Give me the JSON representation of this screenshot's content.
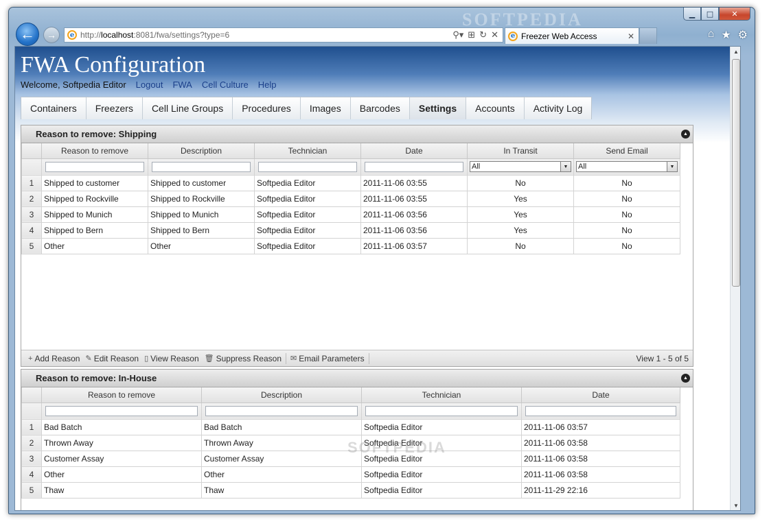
{
  "browser": {
    "watermark": "SOFTPEDIA",
    "url_prefix": "http://",
    "url_host": "localhost",
    "url_rest": ":8081/fwa/settings?type=6",
    "tab_title": "Freezer Web Access"
  },
  "header": {
    "title": "FWA Configuration",
    "welcome": "Welcome, Softpedia Editor",
    "links": [
      "Logout",
      "FWA",
      "Cell Culture",
      "Help"
    ]
  },
  "nav_tabs": [
    "Containers",
    "Freezers",
    "Cell Line Groups",
    "Procedures",
    "Images",
    "Barcodes",
    "Settings",
    "Accounts",
    "Activity Log"
  ],
  "active_tab": "Settings",
  "shipping": {
    "title": "Reason to remove: Shipping",
    "columns": [
      "Reason to remove",
      "Description",
      "Technician",
      "Date",
      "In Transit",
      "Send Email"
    ],
    "filter_all": "All",
    "rows": [
      [
        "1",
        "Shipped to customer",
        "Shipped to customer",
        "Softpedia Editor",
        "2011-11-06 03:55",
        "No",
        "No"
      ],
      [
        "2",
        "Shipped to Rockville",
        "Shipped to Rockville",
        "Softpedia Editor",
        "2011-11-06 03:55",
        "Yes",
        "No"
      ],
      [
        "3",
        "Shipped to Munich",
        "Shipped to Munich",
        "Softpedia Editor",
        "2011-11-06 03:56",
        "Yes",
        "No"
      ],
      [
        "4",
        "Shipped to Bern",
        "Shipped to Bern",
        "Softpedia Editor",
        "2011-11-06 03:56",
        "Yes",
        "No"
      ],
      [
        "5",
        "Other",
        "Other",
        "Softpedia Editor",
        "2011-11-06 03:57",
        "No",
        "No"
      ]
    ],
    "pager": {
      "add": "Add Reason",
      "edit": "Edit Reason",
      "view": "View Reason",
      "suppress": "Suppress Reason",
      "email": "Email Parameters",
      "info": "View 1 - 5 of 5"
    }
  },
  "inhouse": {
    "title": "Reason to remove: In-House",
    "columns": [
      "Reason to remove",
      "Description",
      "Technician",
      "Date"
    ],
    "rows": [
      [
        "1",
        "Bad Batch",
        "Bad Batch",
        "Softpedia Editor",
        "2011-11-06 03:57"
      ],
      [
        "2",
        "Thrown Away",
        "Thrown Away",
        "Softpedia Editor",
        "2011-11-06 03:58"
      ],
      [
        "3",
        "Customer Assay",
        "Customer Assay",
        "Softpedia Editor",
        "2011-11-06 03:58"
      ],
      [
        "4",
        "Other",
        "Other",
        "Softpedia Editor",
        "2011-11-06 03:58"
      ],
      [
        "5",
        "Thaw",
        "Thaw",
        "Softpedia Editor",
        "2011-11-29 22:16"
      ]
    ]
  },
  "colors": {
    "accent": "#1a3f8a",
    "header_blue": "#1f4f8e"
  },
  "icons": [
    "back-arrow-icon",
    "forward-arrow-icon",
    "ie-icon",
    "home-icon",
    "star-icon",
    "gear-icon",
    "collapse-icon",
    "plus-icon",
    "pencil-icon",
    "document-icon",
    "trash-icon",
    "email-icon"
  ]
}
